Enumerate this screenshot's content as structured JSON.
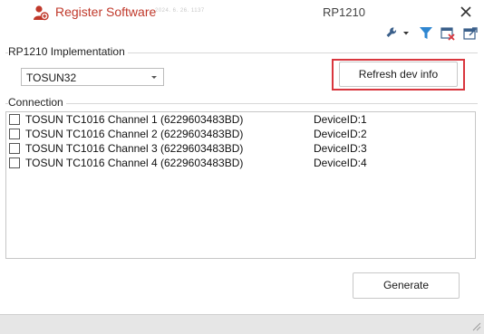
{
  "window": {
    "title": "Register Software",
    "version": "2024. 6. 26. 1137",
    "subtitle": "RP1210",
    "close_glyph": "✕"
  },
  "icons": {
    "app": "user-plus-icon",
    "close": "close-icon",
    "toolbar": [
      "wrench-dropdown-icon",
      "filter-icon",
      "clear-window-icon",
      "export-window-icon"
    ]
  },
  "colors": {
    "title": "#c0392b",
    "highlight": "#d9363e",
    "filter": "#2e86d1"
  },
  "rp1210": {
    "group_title": "RP1210 Implementation",
    "selected": "TOSUN32",
    "refresh_label": "Refresh dev info"
  },
  "connection": {
    "group_title": "Connection",
    "rows": [
      {
        "name": "TOSUN TC1016 Channel 1 (6229603483BD)",
        "device_id": "DeviceID:1",
        "checked": false
      },
      {
        "name": "TOSUN TC1016 Channel 2 (6229603483BD)",
        "device_id": "DeviceID:2",
        "checked": false
      },
      {
        "name": "TOSUN TC1016 Channel 3 (6229603483BD)",
        "device_id": "DeviceID:3",
        "checked": false
      },
      {
        "name": "TOSUN TC1016 Channel 4 (6229603483BD)",
        "device_id": "DeviceID:4",
        "checked": false
      }
    ]
  },
  "actions": {
    "generate_label": "Generate"
  }
}
